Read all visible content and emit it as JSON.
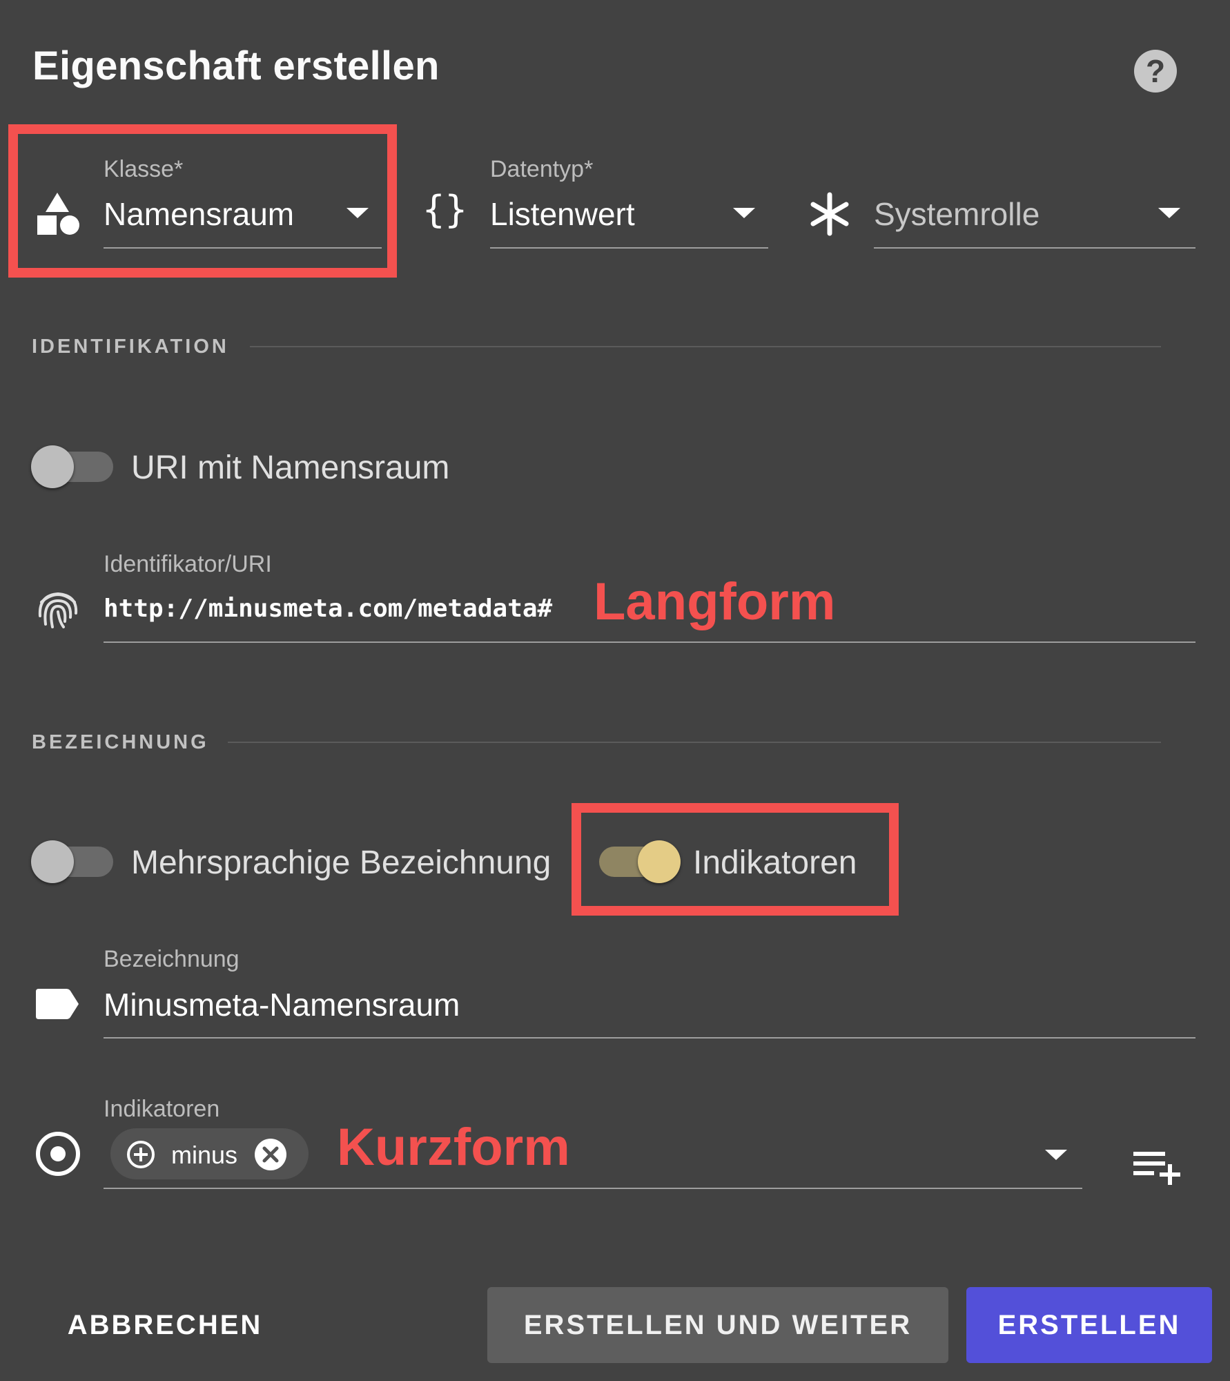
{
  "dialog": {
    "title": "Eigenschaft erstellen",
    "help_icon": "help-circle-icon",
    "help_glyph": "?"
  },
  "fields": {
    "klasse": {
      "label": "Klasse*",
      "value": "Namensraum",
      "icon": "shapes-icon"
    },
    "datentyp": {
      "label": "Datentyp*",
      "value": "Listenwert",
      "icon": "curly-braces-icon",
      "icon_glyph": "{}"
    },
    "systemrolle": {
      "placeholder": "Systemrolle",
      "icon": "asterisk-icon"
    }
  },
  "sections": {
    "identifikation": "IDENTIFIKATION",
    "bezeichnung": "BEZEICHNUNG"
  },
  "toggles": {
    "uri_namensraum": {
      "label": "URI mit Namensraum",
      "on": false
    },
    "mehrsprachig": {
      "label": "Mehrsprachige Bezeichnung",
      "on": false
    },
    "indikatoren": {
      "label": "Indikatoren",
      "on": true
    }
  },
  "identifier": {
    "label": "Identifikator/URI",
    "value": "http://minusmeta.com/metadata#",
    "icon": "fingerprint-icon"
  },
  "bezeichnung": {
    "label": "Bezeichnung",
    "value": "Minusmeta-Namensraum",
    "icon": "label-tag-icon"
  },
  "indikatoren_field": {
    "label": "Indikatoren",
    "icon": "radio-target-icon",
    "chip": {
      "label": "minus",
      "icon": "plus-circle-icon",
      "remove_icon": "close-circle-icon"
    },
    "add_icon": "playlist-add-icon"
  },
  "annotations": {
    "langform": "Langform",
    "kurzform": "Kurzform"
  },
  "annotation_color": "#f4514f",
  "buttons": {
    "cancel": "ABBRECHEN",
    "create_continue": "ERSTELLEN UND WEITER",
    "create": "ERSTELLEN"
  },
  "colors": {
    "background": "#424242",
    "primary": "#5350d9",
    "toggle_on": "#e4cc86",
    "secondary_button": "#5e5e5e"
  }
}
